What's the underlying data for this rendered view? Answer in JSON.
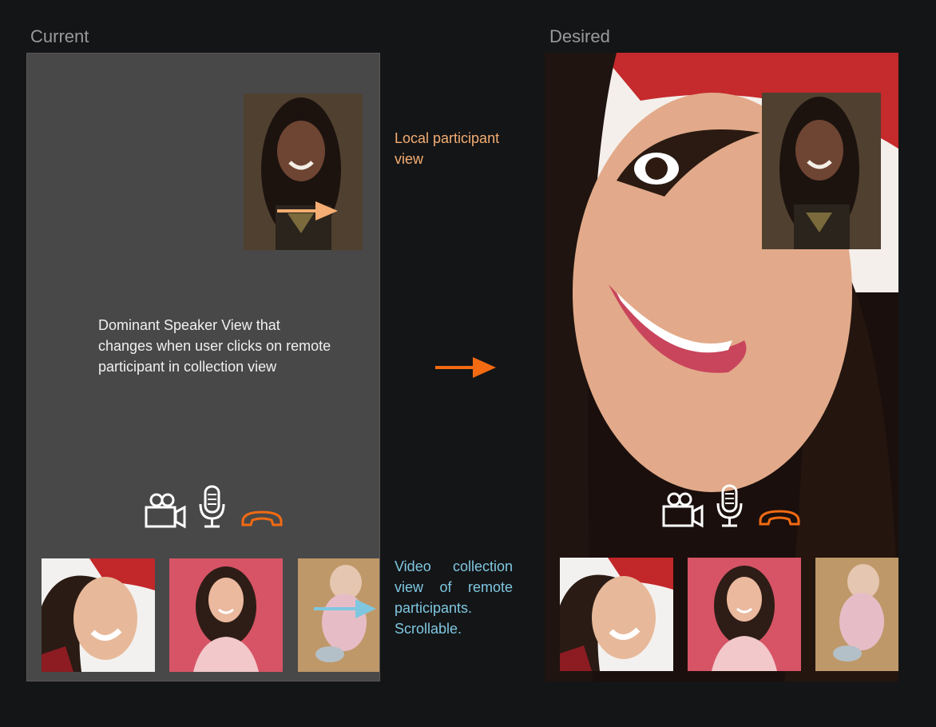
{
  "headings": {
    "current": "Current",
    "desired": "Desired"
  },
  "current_panel": {
    "dominant_label": "Dominant Speaker View  that changes when user clicks on remote participant in collection view"
  },
  "annotations": {
    "local": "Local participant view",
    "collection": "Video collection view of remote participants. Scrollable."
  },
  "icons": {
    "camera": "video-camera-icon",
    "mic": "microphone-icon",
    "hangup": "hang-up-icon",
    "arrow": "right-arrow-icon"
  },
  "colors": {
    "local_annotation": "#f4ad72",
    "collection_annotation": "#7fc7e0",
    "transition_arrow": "#f26a12",
    "hangup": "#f26a12",
    "panel_bg": "#484848"
  }
}
